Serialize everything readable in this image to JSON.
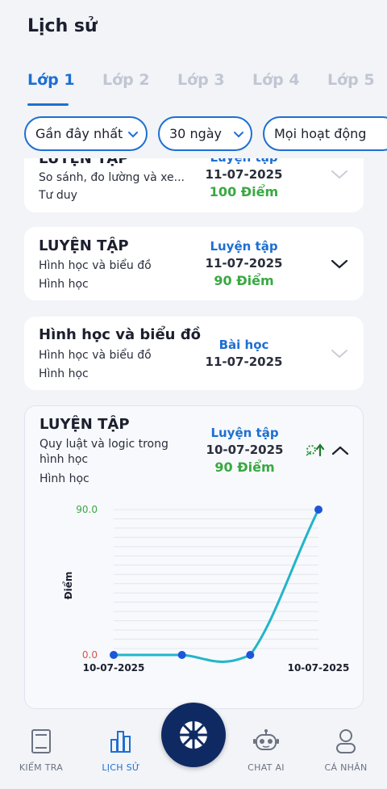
{
  "header": {
    "title": "Lịch sử"
  },
  "tabs": [
    {
      "label": "Lớp 1",
      "active": true
    },
    {
      "label": "Lớp 2",
      "active": false
    },
    {
      "label": "Lớp 3",
      "active": false
    },
    {
      "label": "Lớp 4",
      "active": false
    },
    {
      "label": "Lớp 5",
      "active": false
    }
  ],
  "filters": {
    "sort": "Gần đây nhất",
    "range": "30 ngày",
    "activity": "Mọi hoạt động"
  },
  "cards": [
    {
      "title": "LUYỆN TẬP",
      "subtitle": "So sánh, đo lường và xe...",
      "category": "Tư duy",
      "type": "Luyện tập",
      "date": "11-07-2025",
      "score": "100 Điểm"
    },
    {
      "title": "LUYỆN TẬP",
      "subtitle": "Hình học và biểu đồ",
      "category": "Hình học",
      "type": "Luyện tập",
      "date": "11-07-2025",
      "score": "90 Điểm"
    },
    {
      "title": "Hình học và biểu đồ",
      "subtitle": "Hình học và biểu đồ",
      "category": "Hình học",
      "type": "Bài học",
      "date": "11-07-2025",
      "score": ""
    },
    {
      "title": "LUYỆN TẬP",
      "subtitle": "Quy luật và logic trong hình học",
      "category": "Hình học",
      "type": "Luyện tập",
      "date": "10-07-2025",
      "score": "90 Điểm"
    }
  ],
  "chart_data": {
    "type": "line",
    "x": [
      "10-07-2025",
      "",
      "",
      "10-07-2025"
    ],
    "series": [
      {
        "values": [
          0.0,
          0.0,
          0.0,
          90.0
        ]
      }
    ],
    "ylabel": "Điểm",
    "ylim": [
      0,
      90
    ],
    "ytick_labels": [
      "0.0",
      "90.0"
    ],
    "xtick_labels": [
      "10-07-2025",
      "10-07-2025"
    ],
    "grid": true,
    "line_color": "#22b5c9",
    "point_color": "#1e56d9"
  },
  "nav": [
    {
      "label": "KIỂM TRA",
      "icon": "book-icon",
      "active": false
    },
    {
      "label": "LỊCH SỬ",
      "icon": "bar-chart-icon",
      "active": true
    },
    {
      "label": "CHAT AI",
      "icon": "robot-icon",
      "active": false
    },
    {
      "label": "CÁ NHÂN",
      "icon": "person-icon",
      "active": false
    }
  ],
  "colors": {
    "accent": "#1e6fd1",
    "score": "#3aa843",
    "fab": "#0f2a63"
  }
}
